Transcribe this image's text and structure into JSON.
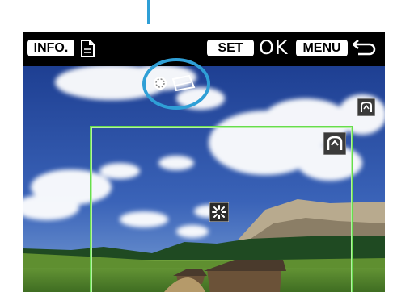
{
  "topbar": {
    "info_label": "INFO.",
    "set_label": "SET",
    "ok_label": "OK",
    "menu_label": "MENU"
  },
  "icons": {
    "document": "document-icon",
    "circle_mode": "circle-mode-icon",
    "tilt_mode": "tilt-icon",
    "return": "return-arrow-icon",
    "corner_small": "corner-icon",
    "corner_frame": "corner-icon",
    "center_af": "center-af-icon"
  },
  "colors": {
    "highlight": "#2f9fd6",
    "frame": "#66dd4d",
    "sky": "#2b4fa3"
  }
}
